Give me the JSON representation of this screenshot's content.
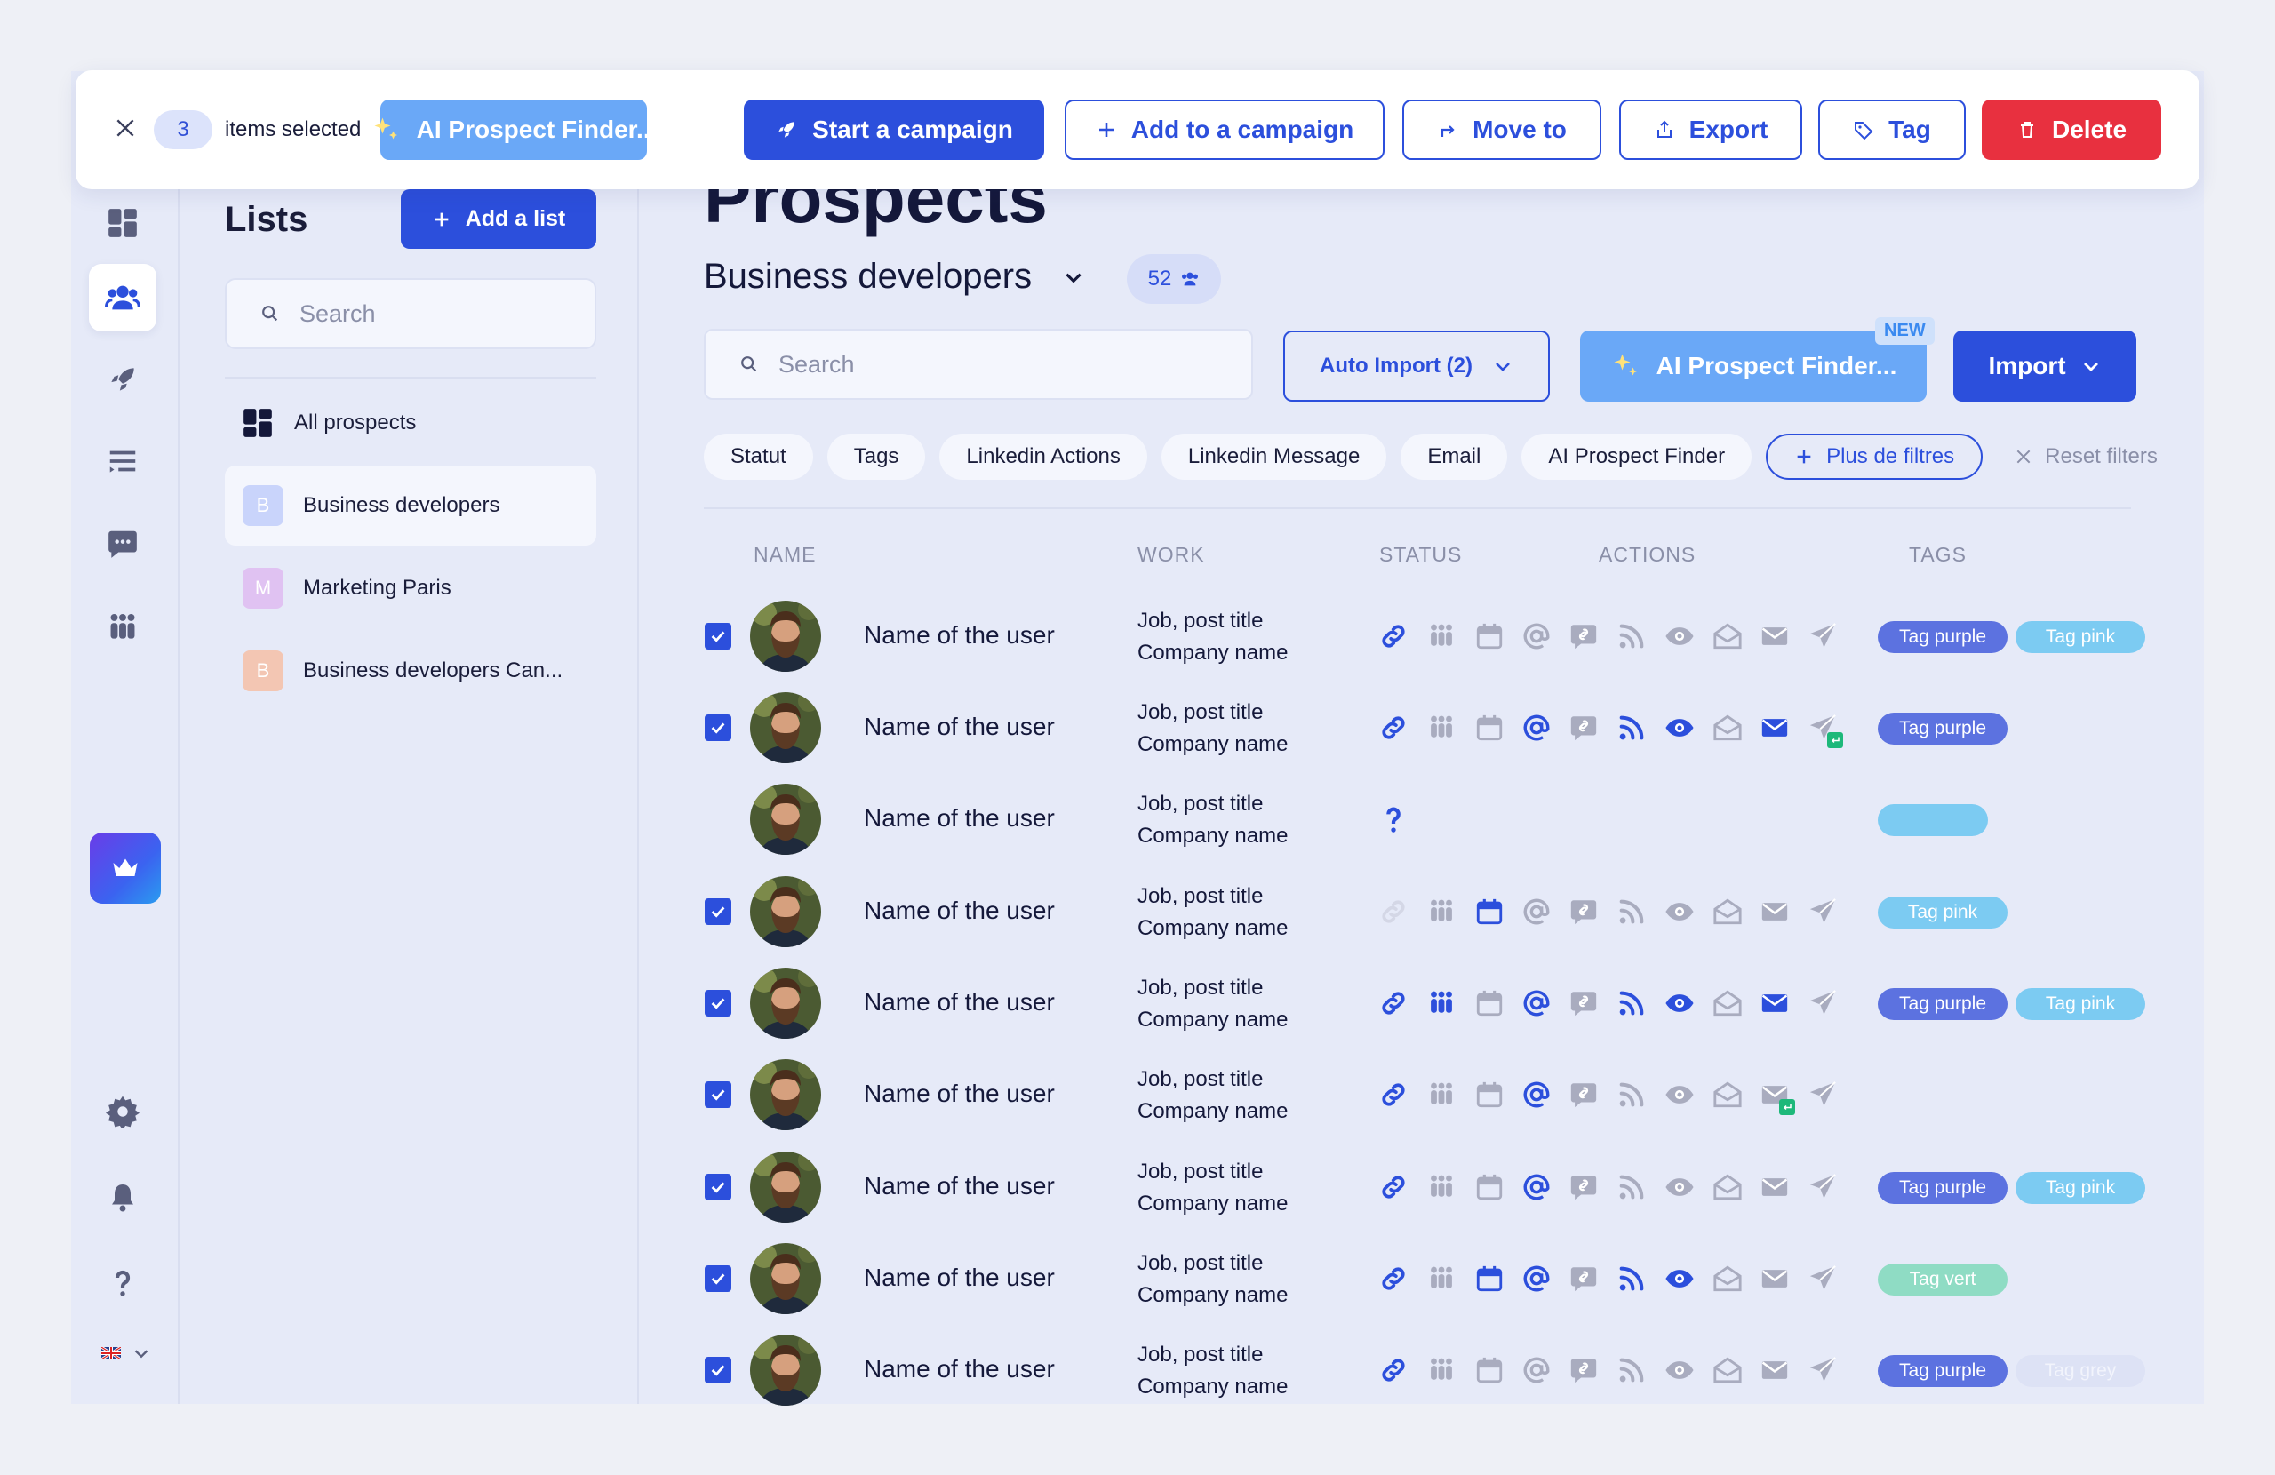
{
  "selection": {
    "count": "3",
    "label": "items selected",
    "actions": {
      "ai": "AI Prospect Finder...",
      "start_campaign": "Start a campaign",
      "add_campaign": "Add to a campaign",
      "move_to": "Move to",
      "export": "Export",
      "tag": "Tag",
      "delete": "Delete"
    }
  },
  "lists_panel": {
    "title": "Lists",
    "add_button": "Add a list",
    "search_placeholder": "Search",
    "all_prospects": "All prospects",
    "items": [
      {
        "initial": "B",
        "label": "Business developers",
        "color": "#c9d4fb",
        "active": true
      },
      {
        "initial": "M",
        "label": "Marketing Paris",
        "color": "#e0c2f2",
        "active": false
      },
      {
        "initial": "B",
        "label": "Business developers Can...",
        "color": "#f3c6b3",
        "active": false
      }
    ]
  },
  "main": {
    "page_title": "Prospects",
    "list_name": "Business developers",
    "list_count": "52",
    "search_placeholder": "Search",
    "auto_import": "Auto Import (2)",
    "ai_finder": "AI Prospect Finder...",
    "new_badge": "NEW",
    "import": "Import",
    "filters": [
      "Statut",
      "Tags",
      "Linkedin Actions",
      "Linkedin Message",
      "Email",
      "AI Prospect Finder"
    ],
    "more_filters": "Plus de filtres",
    "reset_filters": "Reset filters",
    "columns": {
      "name": "NAME",
      "work": "WORK",
      "status": "STATUS",
      "actions": "ACTIONS",
      "tags": "TAGS"
    }
  },
  "colors": {
    "accent": "#2c4fdc",
    "tag_purple": "#5c72e0",
    "tag_pink": "#7ccbf2",
    "tag_vert": "#8fdcc4",
    "tag_grey": "#dde2f5",
    "muted_icon": "#a9acbf",
    "delete": "#e8303f"
  },
  "rows": [
    {
      "name": "Name of the user",
      "job": "Job, post title",
      "company": "Company name",
      "checked": true,
      "status": {
        "link": true,
        "team": false,
        "calendar": false,
        "at": false,
        "question": false,
        "link_faded": false
      },
      "actions": {
        "linkedin": false,
        "rss": false,
        "eye": false,
        "mailopen": false,
        "mail": false,
        "send": false,
        "send_badge": false,
        "mail_badge": false,
        "hidden": false
      },
      "tags": [
        {
          "label": "Tag purple",
          "color": "#5c72e0"
        },
        {
          "label": "Tag pink",
          "color": "#7ccbf2"
        }
      ]
    },
    {
      "name": "Name of the user",
      "job": "Job, post title",
      "company": "Company name",
      "checked": true,
      "status": {
        "link": true,
        "team": false,
        "calendar": false,
        "at": true,
        "question": false,
        "link_faded": false
      },
      "actions": {
        "linkedin": false,
        "rss": true,
        "eye": true,
        "mailopen": false,
        "mail": true,
        "send": false,
        "send_badge": true,
        "mail_badge": false,
        "hidden": false
      },
      "tags": [
        {
          "label": "Tag purple",
          "color": "#5c72e0"
        }
      ]
    },
    {
      "name": "Name of the user",
      "job": "Job, post title",
      "company": "Company name",
      "checked": false,
      "status": {
        "link": false,
        "team": false,
        "calendar": false,
        "at": false,
        "question": true,
        "link_faded": false
      },
      "actions": {
        "hidden": true
      },
      "tags": [
        {
          "label": "",
          "color": "#7ccbf2"
        }
      ]
    },
    {
      "name": "Name of the user",
      "job": "Job, post title",
      "company": "Company name",
      "checked": true,
      "status": {
        "link": false,
        "team": false,
        "calendar": true,
        "at": false,
        "question": false,
        "link_faded": true
      },
      "actions": {
        "linkedin": false,
        "rss": false,
        "eye": false,
        "mailopen": false,
        "mail": false,
        "send": false,
        "send_badge": false,
        "mail_badge": false,
        "hidden": false
      },
      "tags": [
        {
          "label": "Tag pink",
          "color": "#7ccbf2"
        }
      ]
    },
    {
      "name": "Name of the user",
      "job": "Job, post title",
      "company": "Company name",
      "checked": true,
      "status": {
        "link": true,
        "team": true,
        "calendar": false,
        "at": true,
        "question": false,
        "link_faded": false
      },
      "actions": {
        "linkedin": false,
        "rss": true,
        "eye": true,
        "mailopen": false,
        "mail": true,
        "send": false,
        "send_badge": false,
        "mail_badge": false,
        "hidden": false
      },
      "tags": [
        {
          "label": "Tag purple",
          "color": "#5c72e0"
        },
        {
          "label": "Tag pink",
          "color": "#7ccbf2"
        }
      ]
    },
    {
      "name": "Name of the user",
      "job": "Job, post title",
      "company": "Company name",
      "checked": true,
      "status": {
        "link": true,
        "team": false,
        "calendar": false,
        "at": true,
        "question": false,
        "link_faded": false
      },
      "actions": {
        "linkedin": false,
        "rss": false,
        "eye": false,
        "mailopen": false,
        "mail": false,
        "send": false,
        "send_badge": false,
        "mail_badge": true,
        "hidden": false
      },
      "tags": []
    },
    {
      "name": "Name of the user",
      "job": "Job, post title",
      "company": "Company name",
      "checked": true,
      "status": {
        "link": true,
        "team": false,
        "calendar": false,
        "at": true,
        "question": false,
        "link_faded": false
      },
      "actions": {
        "linkedin": false,
        "rss": false,
        "eye": false,
        "mailopen": false,
        "mail": false,
        "send": false,
        "send_badge": false,
        "mail_badge": false,
        "hidden": false
      },
      "tags": [
        {
          "label": "Tag purple",
          "color": "#5c72e0"
        },
        {
          "label": "Tag pink",
          "color": "#7ccbf2"
        }
      ]
    },
    {
      "name": "Name of the user",
      "job": "Job, post title",
      "company": "Company name",
      "checked": true,
      "status": {
        "link": true,
        "team": false,
        "calendar": true,
        "at": true,
        "question": false,
        "link_faded": false
      },
      "actions": {
        "linkedin": false,
        "rss": true,
        "eye": true,
        "mailopen": false,
        "mail": false,
        "send": false,
        "send_badge": false,
        "mail_badge": false,
        "hidden": false
      },
      "tags": [
        {
          "label": "Tag vert",
          "color": "#8fdcc4"
        }
      ]
    },
    {
      "name": "Name of the user",
      "job": "Job, post title",
      "company": "Company name",
      "checked": true,
      "status": {
        "link": true,
        "team": false,
        "calendar": false,
        "at": false,
        "question": false,
        "link_faded": false
      },
      "actions": {
        "linkedin": false,
        "rss": false,
        "eye": false,
        "mailopen": false,
        "mail": false,
        "send": false,
        "send_badge": false,
        "mail_badge": false,
        "hidden": false
      },
      "tags": [
        {
          "label": "Tag purple",
          "color": "#5c72e0"
        },
        {
          "label": "Tag grey",
          "color": "#dde2f5"
        }
      ]
    }
  ]
}
